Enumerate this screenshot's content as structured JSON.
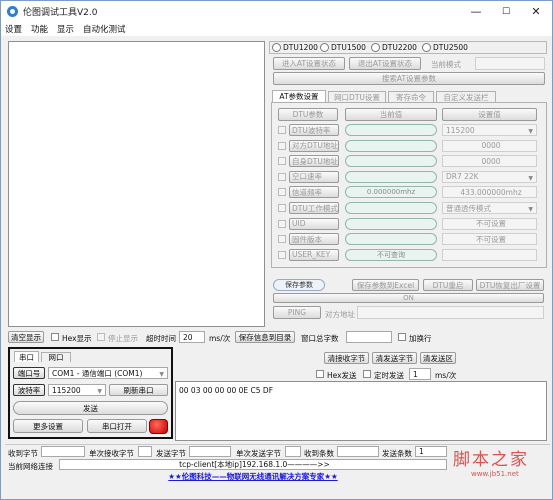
{
  "window": {
    "title": "伦图调试工具V2.0",
    "min": "—",
    "max": "☐",
    "close": "✕"
  },
  "menu": [
    "设置",
    "功能",
    "显示",
    "自动化测试"
  ],
  "dtu_options": [
    "DTU1200",
    "DTU1500",
    "DTU2200",
    "DTU2500"
  ],
  "at_buttons": {
    "enter": "进入AT设置状态",
    "exit": "退出AT设置状态",
    "current_mode": "当前模式",
    "search": "搜索AT设置参数"
  },
  "tabs": [
    "AT参数设置",
    "网口DTU设置",
    "寄存命令",
    "自定义发送栏"
  ],
  "param_table": {
    "headers": [
      "DTU参数",
      "当前值",
      "设置值"
    ],
    "rows": [
      {
        "name": "DTU波特率",
        "current": "",
        "setting": "115200",
        "type": "select"
      },
      {
        "name": "对方DTU地址",
        "current": "",
        "setting": "0000",
        "type": "text"
      },
      {
        "name": "自身DTU地址",
        "current": "",
        "setting": "0000",
        "type": "text"
      },
      {
        "name": "空口速率",
        "current": "",
        "setting": "DR7    22K",
        "type": "select"
      },
      {
        "name": "信道频率",
        "current": "0.000000mhz",
        "setting": "433.000000mhz",
        "type": "text"
      },
      {
        "name": "DTU工作模式",
        "current": "",
        "setting": "普通透传模式",
        "type": "select"
      },
      {
        "name": "UID",
        "current": "",
        "setting": "不可设置",
        "type": "text"
      },
      {
        "name": "固件版本",
        "current": "",
        "setting": "不可设置",
        "type": "text"
      },
      {
        "name": "USER_KEY",
        "current": "不可查询",
        "setting": "",
        "type": "text"
      }
    ]
  },
  "param_actions": {
    "save": "保存参数",
    "save_excel": "保存参数到Excel",
    "dtu_restart": "DTU重启",
    "dtu_factory": "DTU恢复出厂设置",
    "on_label": "ON",
    "ping": "PING",
    "peer_addr": "对方地址"
  },
  "bottom_bar": {
    "clear": "清空显示",
    "hex_show": "Hex显示",
    "stop_show": "停止显示",
    "timeout_label": "超时时间",
    "timeout_value": "20",
    "timeout_unit": "ms/次",
    "save_to_dir": "保存信息到目录",
    "window_total": "窗口总字数",
    "wrap": "加换行"
  },
  "serial": {
    "tabs": [
      "串口",
      "网口"
    ],
    "port_label": "端口号",
    "port_value": "COM1 - 通信端口 (COM1)",
    "baud_label": "波特率",
    "baud_value": "115200",
    "refresh": "刷新串口",
    "send": "发送",
    "more": "更多设置",
    "open": "串口打开"
  },
  "send_area": {
    "clear_rx": "清接收字节",
    "clear_tx": "清发送字节",
    "clear_area": "清发送区",
    "hex_send": "Hex发送",
    "timed_send": "定时发送",
    "interval_value": "1",
    "interval_unit": "ms/次",
    "payload": "00 03 00 00 00 0E C5 DF"
  },
  "status": {
    "rx_bytes": "收到字节",
    "single_rx": "单次接收字节",
    "tx_bytes": "发送字节",
    "single_tx": "单次发送字节",
    "rx_count": "收到条数",
    "tx_count": "发送条数",
    "tx_count_value": "1",
    "conn_label": "当前网络连接",
    "conn_value": "tcp-client[本地ip]192.168.1.0————>>",
    "banner": "★★伦图科技——物联网无线通讯解决方案专家★★"
  },
  "watermark": {
    "text": "脚本之家",
    "url": "www.jb51.net"
  },
  "colors": {
    "accent_red": "#e0201e",
    "banner_blue": "#1a1ad8",
    "led_red": "#e01010",
    "watermark": "#d9534f"
  }
}
